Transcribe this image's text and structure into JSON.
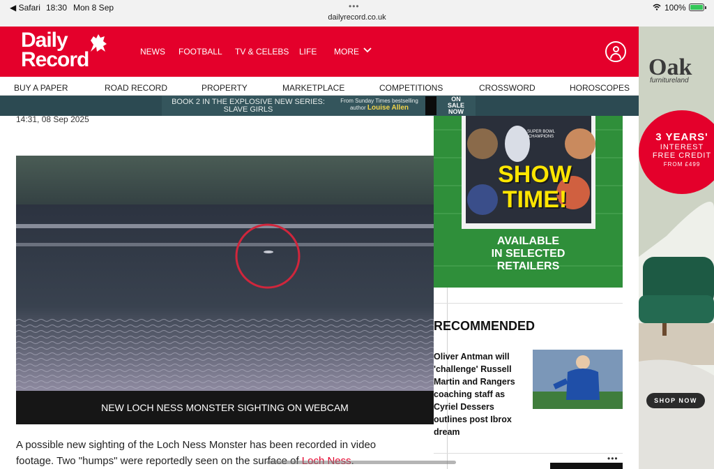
{
  "status_bar": {
    "back_app": "◀ Safari",
    "time": "18:30",
    "date": "Mon 8 Sep",
    "battery": "100%",
    "url": "dailyrecord.co.uk"
  },
  "masthead": {
    "logo_line1": "Daily",
    "logo_line2": "Record",
    "nav": [
      "NEWS",
      "FOOTBALL",
      "TV & CELEBS",
      "LIFE",
      "MORE"
    ],
    "brand_color": "#e4002b"
  },
  "subnav": [
    "BUY A PAPER",
    "ROAD RECORD",
    "PROPERTY",
    "MARKETPLACE",
    "COMPETITIONS",
    "CROSSWORD",
    "HOROSCOPES"
  ],
  "banner": {
    "headline_line1": "BOOK 2 IN THE EXPLOSIVE NEW SERIES:",
    "headline_line2": "SLAVE GIRLS",
    "tagline_line1": "From Sunday Times bestselling",
    "tagline_line2": "author",
    "author": "Louise Allen",
    "sale_line1": "ON",
    "sale_line2": "SALE",
    "sale_line3": "NOW"
  },
  "article": {
    "timestamp": "14:31, 08 Sep 2025",
    "video_caption": "NEW LOCH NESS MONSTER SIGHTING ON WEBCAM",
    "body_line1": "A possible new sighting of the Loch Ness Monster has been recorded in video",
    "body_line2_start": "footage. Two \"humps\" were reportedly seen on the surface of",
    "body_link": "Loch Ness",
    "body_end": "."
  },
  "mag_ad": {
    "cover_headline": "SHOW TIME!",
    "badge": "SUPER BOWL CHAMPIONS",
    "line1": "AVAILABLE",
    "line2": "IN SELECTED",
    "line3": "RETAILERS"
  },
  "recommended": {
    "title": "RECOMMENDED",
    "item_line1": "Oliver Antman will",
    "item_line2": "'challenge' Russell",
    "item_line3": "Martin and Rangers",
    "item_line4": "coaching staff as",
    "item_line5": "Cyriel Dessers",
    "item_line6": "outlines post Ibrox",
    "item_line7": "dream"
  },
  "side_ad": {
    "brand": "Oak",
    "brand_sub": "furnitureland",
    "offer_line1": "3 YEARS'",
    "offer_line2": "INTEREST",
    "offer_line3": "FREE CREDIT",
    "offer_line4": "FROM £499",
    "cta": "SHOP NOW"
  }
}
